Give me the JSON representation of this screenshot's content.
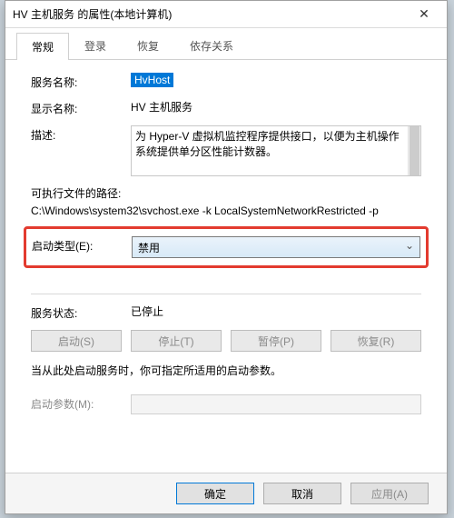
{
  "title": "HV 主机服务 的属性(本地计算机)",
  "close_glyph": "✕",
  "tabs": [
    "常规",
    "登录",
    "恢复",
    "依存关系"
  ],
  "labels": {
    "service_name": "服务名称:",
    "display_name": "显示名称:",
    "description": "描述:",
    "exe_path": "可执行文件的路径:",
    "startup_type": "启动类型(E):",
    "service_status": "服务状态:",
    "note": "当从此处启动服务时，你可指定所适用的启动参数。",
    "start_params": "启动参数(M):"
  },
  "values": {
    "service_name": "HvHost",
    "display_name": "HV 主机服务",
    "description": "为 Hyper-V 虚拟机监控程序提供接口，以便为主机操作系统提供单分区性能计数器。",
    "exe_path": "C:\\Windows\\system32\\svchost.exe -k LocalSystemNetworkRestricted -p",
    "startup_type": "禁用",
    "service_status": "已停止"
  },
  "buttons": {
    "start": "启动(S)",
    "stop": "停止(T)",
    "pause": "暂停(P)",
    "resume": "恢复(R)",
    "ok": "确定",
    "cancel": "取消",
    "apply": "应用(A)"
  }
}
